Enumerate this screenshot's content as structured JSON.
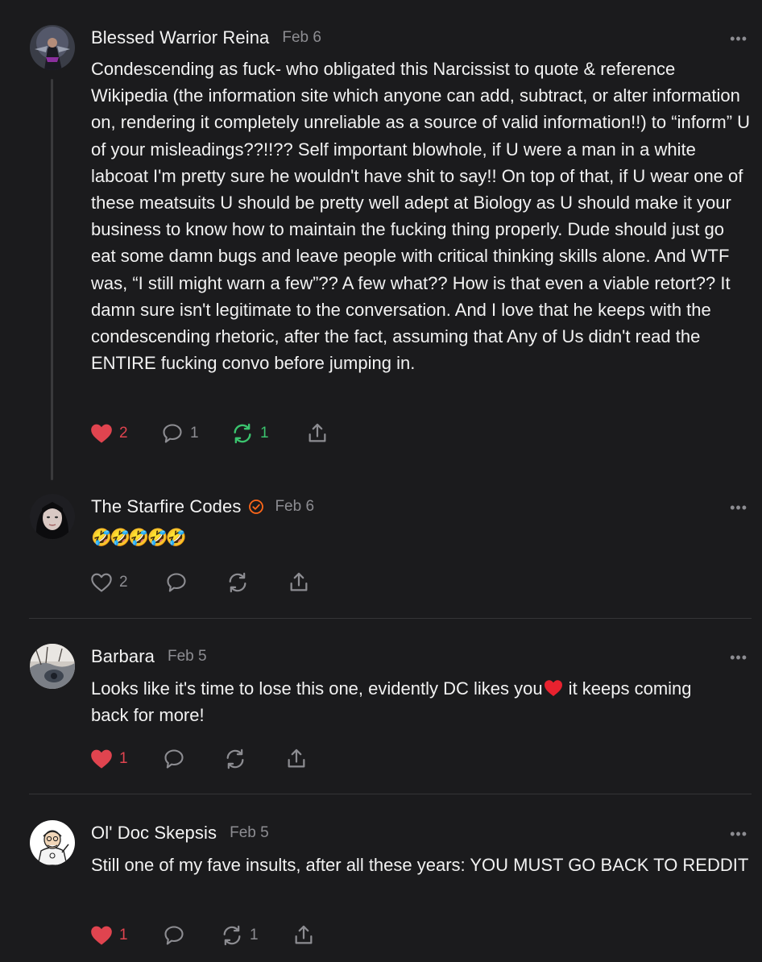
{
  "comments": [
    {
      "author": "Blessed Warrior Reina",
      "date": "Feb 6",
      "text": "Condescending as fuck- who obligated this Narcissist to quote & reference Wikipedia (the information site which anyone can add, subtract, or alter information on, rendering it completely unreliable as a source of valid information!!) to “inform” U of your misleadings??!!?? Self important blowhole, if U were a man in a white labcoat I'm pretty sure he wouldn't have shit to say!! On top of that, if U wear one of these meatsuits U should be pretty well adept at Biology as U should make it your business to know how to maintain the fucking thing properly. Dude should just go eat some damn bugs and leave people with critical thinking skills alone. And WTF was, “I still might warn a few”?? A few what?? How is that even a viable retort?? It damn sure isn't legitimate to the conversation. And I love that he keeps with the condescending rhetoric, after the fact, assuming that Any of Us didn't read the ENTIRE fucking convo before jumping in.",
      "likes": "2",
      "liked": true,
      "replies": "1",
      "restacks": "1",
      "restacked": true
    },
    {
      "author": "The Starfire Codes",
      "date": "Feb 6",
      "verified": true,
      "text": "🤣🤣🤣🤣🤣",
      "likes": "2",
      "liked": false
    },
    {
      "author": "Barbara",
      "date": "Feb 5",
      "text_before_heart": "Looks like it's time to lose this one, evidently DC likes you",
      "text_after_heart": " it keeps coming back for more!",
      "likes": "1",
      "liked": true
    },
    {
      "author": "Ol' Doc Skepsis",
      "date": "Feb 5",
      "text": "Still one of my fave insults, after all these years: YOU MUST GO BACK TO REDDIT",
      "likes": "1",
      "liked": true,
      "restacks": "1"
    }
  ],
  "more_label": "•••",
  "icons": [
    "heart-icon",
    "comment-icon",
    "restack-icon",
    "share-icon",
    "verified-icon",
    "more-icon"
  ],
  "colors": {
    "background": "#1b1b1d",
    "like": "#e0444f",
    "restack": "#3bc46e",
    "muted": "#8d8d92",
    "verified": "#ff6719"
  }
}
